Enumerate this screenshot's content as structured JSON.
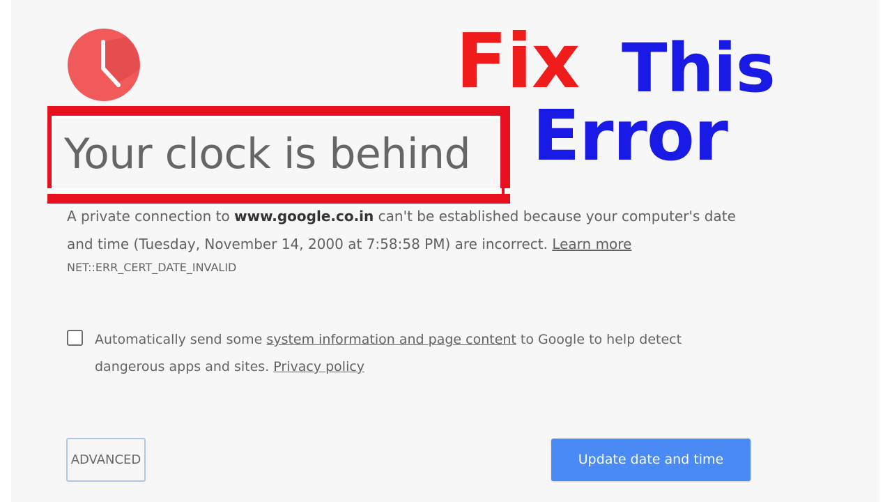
{
  "promo": {
    "fix": "Fix",
    "this": "This",
    "error": "Error"
  },
  "interstitial": {
    "icon": "clock-icon",
    "title": "Your clock is behind",
    "body": {
      "part1": "A private connection to ",
      "domain": "www.google.co.in",
      "part2": " can't be established because your computer's date and time (Tuesday, November 14, 2000 at 7:58:58 PM) are incorrect. ",
      "learn_more": "Learn more"
    },
    "error_code": "NET::ERR_CERT_DATE_INVALID",
    "optin": {
      "checked": false,
      "part1": "Automatically send some ",
      "link1": "system information and page content",
      "part2": " to Google to help detect dangerous apps and sites. ",
      "link2": "Privacy policy"
    },
    "advanced_label": "ADVANCED",
    "update_label": "Update date and time"
  },
  "colors": {
    "background": "#f7f7f7",
    "clock_red": "#f15a5a",
    "highlight_red": "#e8101d",
    "promo_red": "#f01b1b",
    "promo_blue": "#1a1ae6",
    "primary_button": "#4a8af4"
  }
}
